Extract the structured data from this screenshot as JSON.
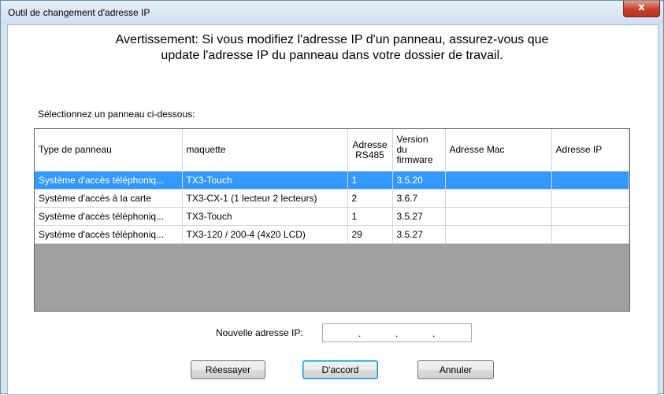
{
  "window": {
    "title": "Outil de changement d'adresse IP",
    "close_glyph": "x"
  },
  "warning": {
    "line1": "Avertissement: Si vous modifiez l'adresse IP d'un panneau, assurez-vous que",
    "line2": "update l'adresse IP du panneau dans votre dossier de travail."
  },
  "select_label": "Sélectionnez un panneau ci-dessous:",
  "table": {
    "headers": {
      "type": "Type de panneau",
      "model": "maquette",
      "rs485_l1": "Adresse",
      "rs485_l2": "RS485",
      "fw_l1": "Version",
      "fw_l2": "du",
      "fw_l3": "firmware",
      "mac": "Adresse Mac",
      "ip": "Adresse IP"
    },
    "rows": [
      {
        "type": "Système d'accès téléphoniq...",
        "model": "TX3-Touch",
        "rs485": "1",
        "fw": "3.5.20",
        "mac": "",
        "ip": "",
        "selected": true
      },
      {
        "type": "Système d'accès à la carte",
        "model": "TX3-CX-1 (1 lecteur 2 lecteurs)",
        "rs485": "2",
        "fw": "3.6.7",
        "mac": "",
        "ip": ""
      },
      {
        "type": "Système d'accès téléphoniq...",
        "model": "TX3-Touch",
        "rs485": "1",
        "fw": "3.5.27",
        "mac": "",
        "ip": ""
      },
      {
        "type": "Système d'accès téléphoniq...",
        "model": "TX3-120 / 200-4 (4x20 LCD)",
        "rs485": "29",
        "fw": "3.5.27",
        "mac": "",
        "ip": ""
      }
    ]
  },
  "ip": {
    "label": "Nouvelle adresse IP:",
    "dot": "."
  },
  "buttons": {
    "retry": "Réessayer",
    "ok": "D'accord",
    "cancel": "Annuler"
  },
  "colors": {
    "selection": "#3399ff",
    "empty_grid": "#a0a0a0",
    "close_button": "#c4402b"
  }
}
